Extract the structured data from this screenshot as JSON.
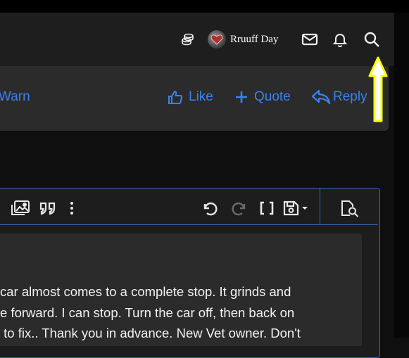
{
  "header": {
    "user_name": "Rruuff Day",
    "icons": [
      "coins-icon",
      "envelope-icon",
      "bell-icon",
      "search-icon"
    ]
  },
  "post_actions": {
    "warn": "Warn",
    "like": "Like",
    "quote": "Quote",
    "reply": "Reply"
  },
  "editor": {
    "toolbar_icons": [
      "media-icon",
      "quote-icon",
      "more-options-icon",
      "undo-icon",
      "redo-icon",
      "bbcode-icon",
      "drafts-icon",
      "preview-icon"
    ],
    "text_lines": [
      "car almost comes to a complete stop. It grinds and",
      "e forward. I can stop. Turn the car off, then back on",
      " to fix.. Thank you in advance. New Vet owner. Don't"
    ]
  },
  "colors": {
    "accent": "#3a82f0",
    "annotation_arrow": "#ffff00"
  }
}
